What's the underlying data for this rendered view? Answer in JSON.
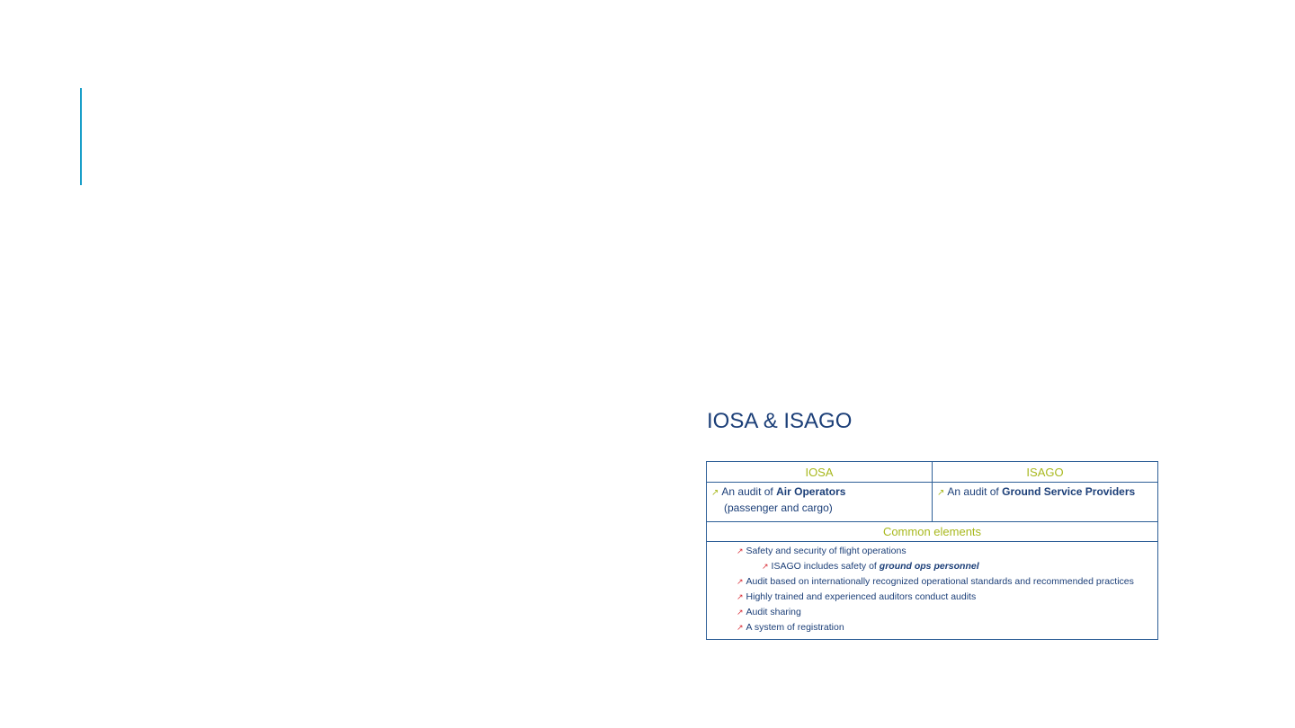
{
  "slide": {
    "heading": "IOSA & ISAGO"
  },
  "table": {
    "columns": [
      {
        "header": "IOSA",
        "desc_prefix": "An audit of ",
        "desc_strong": "Air Operators",
        "desc_line2": "(passenger and cargo)"
      },
      {
        "header": "ISAGO",
        "desc_prefix": "An audit of ",
        "desc_strong": "Ground Service Providers",
        "desc_line2": ""
      }
    ],
    "common_header": "Common elements",
    "common_items": [
      {
        "text": "Safety and security of flight operations"
      },
      {
        "text_prefix": "ISAGO includes safety of ",
        "text_emph": "ground ops personnel"
      },
      {
        "text": "Audit based on internationally recognized operational standards and recommended practices"
      },
      {
        "text": "Highly trained and experienced auditors conduct audits"
      },
      {
        "text": "Audit sharing"
      },
      {
        "text": "A system of registration"
      }
    ]
  },
  "colors": {
    "accent_bar": "#1a9fc9",
    "heading": "#1c3f78",
    "header_text": "#a8b81e",
    "bullet_arrow_lime": "#a8b81e",
    "bullet_arrow_red": "#d9303a",
    "table_border": "#2e5f97"
  },
  "icons": {
    "column_bullet": "arrow-up-right-icon",
    "common_bullet": "arrow-up-right-icon"
  }
}
